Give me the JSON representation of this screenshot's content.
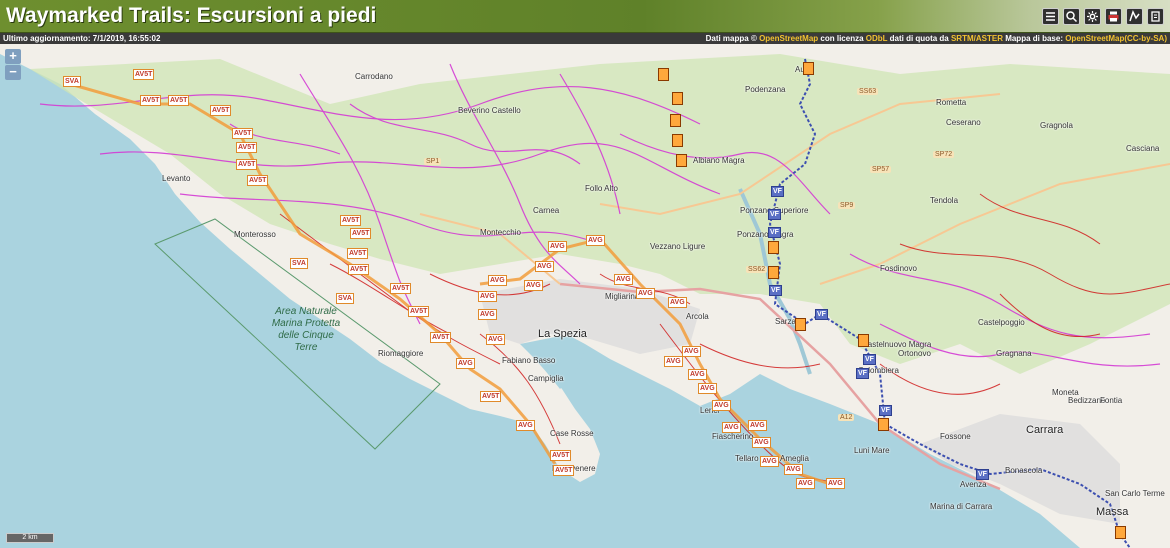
{
  "header": {
    "title": "Waymarked Trails: Escursioni a piedi",
    "tools": [
      {
        "name": "routes-list-icon"
      },
      {
        "name": "search-icon"
      },
      {
        "name": "settings-icon"
      },
      {
        "name": "print-icon"
      },
      {
        "name": "map-key-icon"
      },
      {
        "name": "help-icon"
      }
    ]
  },
  "infobar": {
    "updated": "Ultimo aggiornamento: 7/1/2019, 16:55:02",
    "attr_prefix": "Dati mappa © ",
    "attr_osm": "OpenStreetMap",
    "attr_mid1": " con licenza ",
    "attr_odbl": "ODbL",
    "attr_mid2": " dati di quota da ",
    "attr_srtm": "SRTM/ASTER",
    "attr_mid3": " Mappa di base: ",
    "attr_osm2": "OpenStreetMap",
    "attr_cc": "(CC-by-SA)"
  },
  "zoom": {
    "in": "+",
    "out": "−"
  },
  "scale": {
    "label": "2 km"
  },
  "map": {
    "area_label": "Area Naturale Marina Protetta delle Cinque Terre",
    "labels": [
      {
        "text": "La Spezia",
        "cls": "city"
      },
      {
        "text": "Carrara",
        "cls": "city"
      },
      {
        "text": "Massa",
        "cls": "city"
      },
      {
        "text": "Sarzana",
        "cls": ""
      },
      {
        "text": "Aulla",
        "cls": ""
      },
      {
        "text": "Podenzana",
        "cls": ""
      },
      {
        "text": "Albiano Magra",
        "cls": ""
      },
      {
        "text": "Ponzano Superiore",
        "cls": ""
      },
      {
        "text": "Ponzano Magra",
        "cls": ""
      },
      {
        "text": "Fosdinovo",
        "cls": ""
      },
      {
        "text": "Ceserano",
        "cls": ""
      },
      {
        "text": "Rometta",
        "cls": ""
      },
      {
        "text": "Gragnola",
        "cls": ""
      },
      {
        "text": "Casciana",
        "cls": ""
      },
      {
        "text": "Tendola",
        "cls": ""
      },
      {
        "text": "Monterosso",
        "cls": ""
      },
      {
        "text": "Levanto",
        "cls": ""
      },
      {
        "text": "Riomaggiore",
        "cls": ""
      },
      {
        "text": "Portovenere",
        "cls": ""
      },
      {
        "text": "Lerici",
        "cls": ""
      },
      {
        "text": "Ameglia",
        "cls": ""
      },
      {
        "text": "Luni Mare",
        "cls": ""
      },
      {
        "text": "Marina di Carrara",
        "cls": ""
      },
      {
        "text": "Avenza",
        "cls": ""
      },
      {
        "text": "Migliarina",
        "cls": ""
      },
      {
        "text": "Vezzano Ligure",
        "cls": ""
      },
      {
        "text": "Arcola",
        "cls": ""
      },
      {
        "text": "Follo Alto",
        "cls": ""
      },
      {
        "text": "Carnea",
        "cls": ""
      },
      {
        "text": "Beverino Castello",
        "cls": ""
      },
      {
        "text": "Carrodano",
        "cls": ""
      },
      {
        "text": "Montecchio",
        "cls": ""
      },
      {
        "text": "Fossone",
        "cls": ""
      },
      {
        "text": "Bedizzano",
        "cls": ""
      },
      {
        "text": "Fontia",
        "cls": ""
      },
      {
        "text": "Moneta",
        "cls": ""
      },
      {
        "text": "Castelpoggio",
        "cls": ""
      },
      {
        "text": "Gragnana",
        "cls": ""
      },
      {
        "text": "San Carlo Terme",
        "cls": ""
      },
      {
        "text": "Bonascola",
        "cls": ""
      },
      {
        "text": "Colombiera",
        "cls": ""
      },
      {
        "text": "Castelnuovo Magra",
        "cls": ""
      },
      {
        "text": "Ortonovo",
        "cls": ""
      },
      {
        "text": "Fiascherino",
        "cls": ""
      },
      {
        "text": "Tellaro",
        "cls": ""
      },
      {
        "text": "Fabiano Basso",
        "cls": ""
      },
      {
        "text": "Campiglia",
        "cls": ""
      },
      {
        "text": "Case Rosse",
        "cls": ""
      }
    ],
    "roads": [
      "SS63",
      "SP72",
      "SP57",
      "SP9",
      "SS62",
      "SP1",
      "A12"
    ],
    "shields": [
      "AV5T",
      "AVG",
      "SVA",
      "VF"
    ]
  }
}
